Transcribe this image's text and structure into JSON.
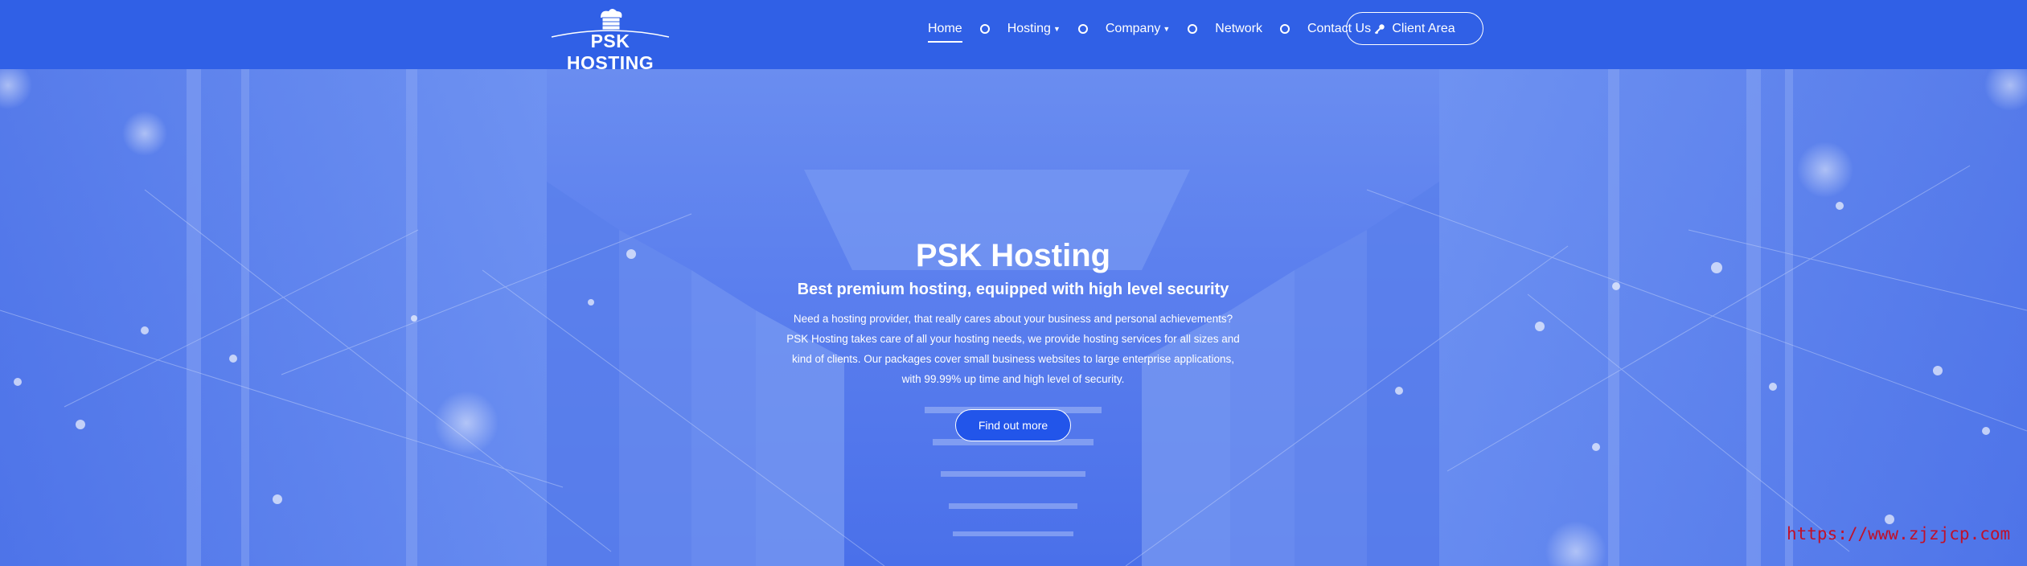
{
  "header": {
    "logo_text": "PSK HOSTING",
    "nav": [
      {
        "label": "Home",
        "active": true,
        "dropdown": false
      },
      {
        "label": "Hosting",
        "active": false,
        "dropdown": true
      },
      {
        "label": "Company",
        "active": false,
        "dropdown": true
      },
      {
        "label": "Network",
        "active": false,
        "dropdown": false
      },
      {
        "label": "Contact Us",
        "active": false,
        "dropdown": false
      }
    ],
    "client_area_label": "Client Area",
    "client_area_icon": "key-icon"
  },
  "hero": {
    "title": "PSK Hosting",
    "subtitle": "Best premium hosting, equipped with high level security",
    "lines": [
      "Need a hosting provider, that really cares about your business and personal achievements?",
      "PSK Hosting takes care of all your hosting needs, we provide hosting services for all sizes and",
      "kind of clients. Our packages cover small business websites to large enterprise applications,",
      "with 99.99% up time and high level of security."
    ],
    "cta_label": "Find out more"
  },
  "watermark": "https://www.zjzjcp.com",
  "colors": {
    "header_bg": "#3060e6",
    "hero_overlay": "#5c80ee",
    "cta_bg": "#2255ea",
    "watermark": "#c0102a"
  }
}
